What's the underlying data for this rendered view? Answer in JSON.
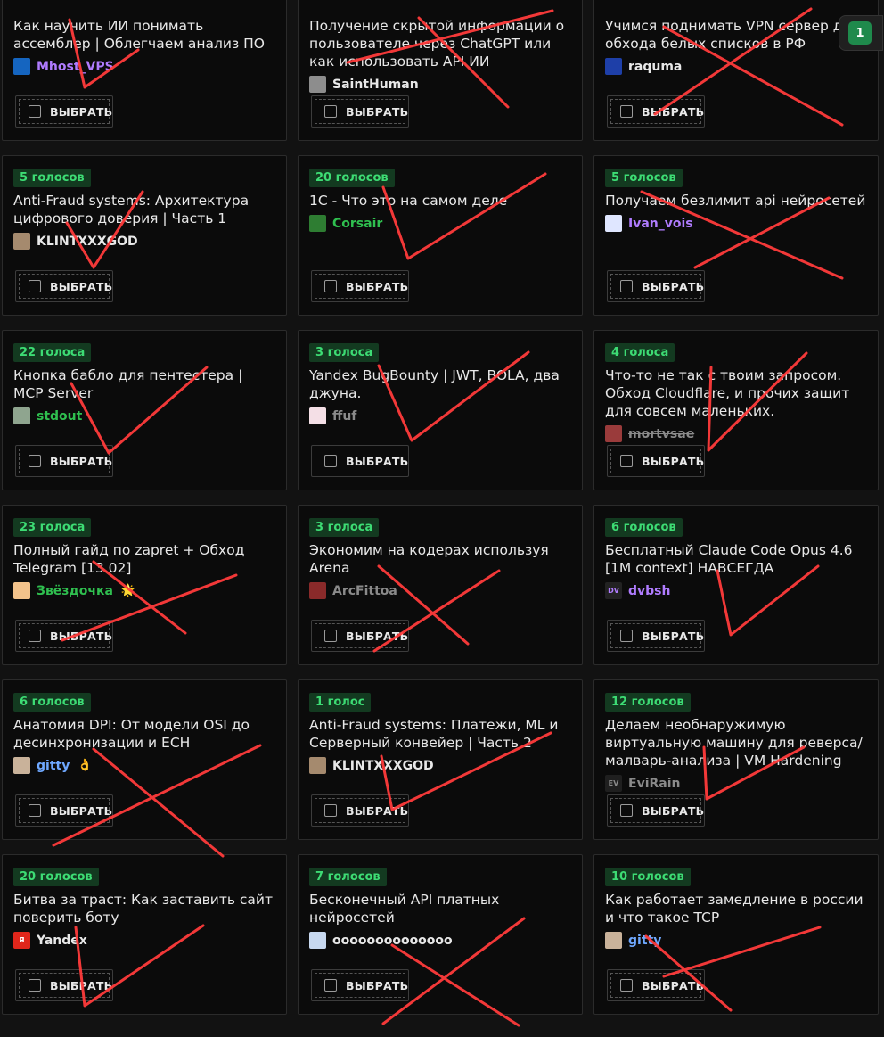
{
  "select_label": "ВЫБРАТЬ",
  "selected_count": "1",
  "cards": [
    {
      "votes": "",
      "title": "Как научить ИИ понимать ассемблер | Облегчаем анализ ПО",
      "author": "Mhost_VPS",
      "author_color": "#b07cff",
      "avatar_color": "#1565c0"
    },
    {
      "votes": "",
      "title": "Получение скрытой информации о пользователе через ChatGPT или как использовать API ИИ",
      "author": "SaintHuman",
      "author_color": "#e8e8e8",
      "avatar_color": "#8d8d8d"
    },
    {
      "votes": "",
      "title": "Учимся поднимать VPN сервер для обхода белых списков в РФ",
      "author": "raquma",
      "author_color": "#e8e8e8",
      "avatar_color": "#1e3fa8"
    },
    {
      "votes": "5 голосов",
      "title": "Anti-Fraud systems: Архитектура цифрового доверия | Часть 1",
      "author": "KLINTXXXGOD",
      "author_color": "#e8e8e8",
      "avatar_color": "#a58a6e"
    },
    {
      "votes": "20 голосов",
      "title": "1С - Что это на самом деле",
      "author": "Corsair",
      "author_color": "#2fbf4f",
      "avatar_color": "#2e7d32"
    },
    {
      "votes": "5 голосов",
      "title": "Получаем безлимит api нейросетей",
      "author": "Ivan_vois",
      "author_color": "#b07cff",
      "avatar_color": "#dfe6ff"
    },
    {
      "votes": "22 голоса",
      "title": "Кнопка бабло для пентестера | MCP Server",
      "author": "stdout",
      "author_color": "#2fbf4f",
      "avatar_color": "#8fa58f"
    },
    {
      "votes": "3 голоса",
      "title": "Yandex BugBounty | JWT, BOLA, два джуна.",
      "author": "ffuf",
      "author_color": "#8a8a8a",
      "avatar_color": "#f4dfe6"
    },
    {
      "votes": "4 голоса",
      "title": "Что-то не так с твоим запросом. Обход Cloudflare, и прочих защит для совсем маленьких.",
      "author": "mortvsae",
      "author_color": "#8a8a8a",
      "avatar_color": "#9a3b3b",
      "strike": true
    },
    {
      "votes": "23 голоса",
      "title": "Полный гайд по zapret + Обход Telegram [13.02]",
      "author": "Звёздочка",
      "author_color": "#2fbf4f",
      "avatar_color": "#f3c38b",
      "emoji": "🌟"
    },
    {
      "votes": "3 голоса",
      "title": "Экономим на кодерах используя Arena",
      "author": "ArcFittoa",
      "author_color": "#8a8a8a",
      "avatar_color": "#8a2a2a"
    },
    {
      "votes": "6 голосов",
      "title": "Бесплатный Claude Code Opus 4.6 [1M context] НАВСЕГДА",
      "author": "dvbsh",
      "author_color": "#b07cff",
      "avatar_color": "#222222",
      "avatar_text": "DV"
    },
    {
      "votes": "6 голосов",
      "title": "Анатомия DPI: От модели OSI до десинхронизации и ECH",
      "author": "gitty",
      "author_color": "#6fa8ff",
      "avatar_color": "#c9b29a",
      "emoji": "👌"
    },
    {
      "votes": "1 голос",
      "title": "Anti-Fraud systems: Платежи, ML и Серверный конвейер | Часть 2",
      "author": "KLINTXXXGOD",
      "author_color": "#e8e8e8",
      "avatar_color": "#a58a6e"
    },
    {
      "votes": "12 голосов",
      "title": "Делаем необнаружимую виртуальную машину для реверса/малварь-анализа | VM Hardening",
      "author": "EviRain",
      "author_color": "#8a8a8a",
      "avatar_color": "#1f1f1f",
      "avatar_text": "EV"
    },
    {
      "votes": "20 голосов",
      "title": "Битва за траст: Как заставить сайт поверить боту",
      "author": "Yandex",
      "author_color": "#e8e8e8",
      "avatar_color": "#e0261b",
      "avatar_text": "Я"
    },
    {
      "votes": "7 голосов",
      "title": "Бесконечный API платных нейросетей",
      "author": "oooooooooooooo",
      "author_color": "#e8e8e8",
      "avatar_color": "#c7d8ef"
    },
    {
      "votes": "10 голосов",
      "title": "Как работает замедление в россии и что такое TCP",
      "author": "gitty",
      "author_color": "#6fa8ff",
      "avatar_color": "#c9b29a"
    }
  ]
}
